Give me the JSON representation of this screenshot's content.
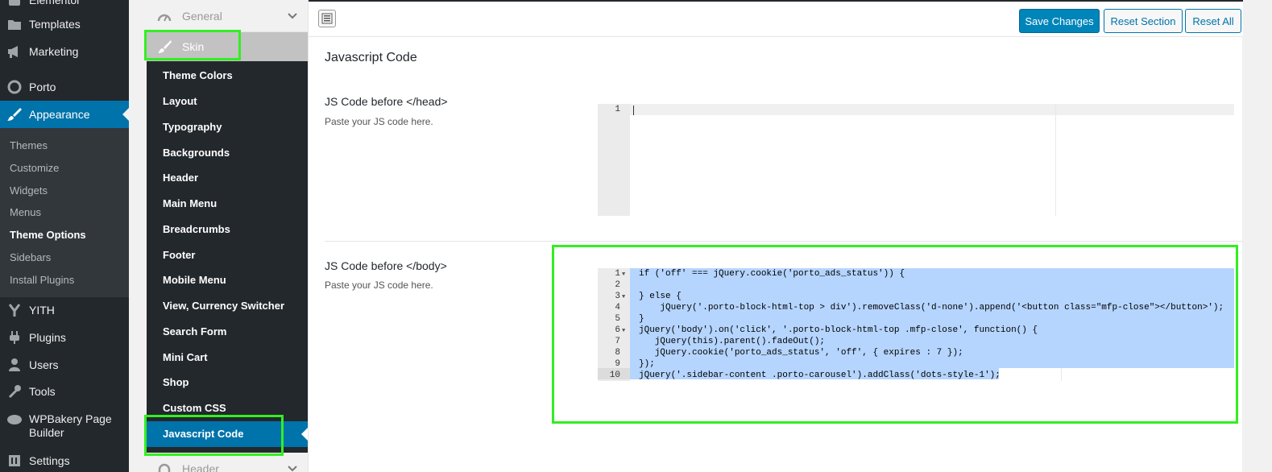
{
  "wp_menu": {
    "items": [
      {
        "label": "Elementor",
        "icon": "elementor-icon"
      },
      {
        "label": "Templates",
        "icon": "folder-icon"
      },
      {
        "label": "Marketing",
        "icon": "megaphone-icon"
      },
      {
        "label": "Porto",
        "icon": "porto-icon"
      },
      {
        "label": "Appearance",
        "icon": "paintbrush-icon"
      },
      {
        "label": "YITH",
        "icon": "yith-icon"
      },
      {
        "label": "Plugins",
        "icon": "plugin-icon"
      },
      {
        "label": "Users",
        "icon": "users-icon"
      },
      {
        "label": "Tools",
        "icon": "wrench-icon"
      },
      {
        "label": "WPBakery Page Builder",
        "icon": "wpbakery-icon"
      },
      {
        "label": "Settings",
        "icon": "settings-icon"
      }
    ],
    "submenu": [
      "Themes",
      "Customize",
      "Widgets",
      "Menus",
      "Theme Options",
      "Sidebars",
      "Install Plugins"
    ]
  },
  "options_nav": {
    "group_general": "General",
    "skin": "Skin",
    "items": [
      "Theme Colors",
      "Layout",
      "Typography",
      "Backgrounds",
      "Header",
      "Main Menu",
      "Breadcrumbs",
      "Footer",
      "Mobile Menu",
      "View, Currency Switcher",
      "Search Form",
      "Mini Cart",
      "Shop",
      "Custom CSS",
      "Javascript Code"
    ],
    "group_header": "Header"
  },
  "toolbar": {
    "save_label": "Save Changes",
    "reset_section_label": "Reset Section",
    "reset_all_label": "Reset All"
  },
  "section": {
    "title": "Javascript Code",
    "fields": [
      {
        "label": "JS Code before </head>",
        "desc": "Paste your JS code here.",
        "line_numbers": [
          "1"
        ],
        "code": []
      },
      {
        "label": "JS Code before </body>",
        "desc": "Paste your JS code here.",
        "line_numbers": [
          "1",
          "2",
          "3",
          "4",
          "5",
          "6",
          "7",
          "8",
          "9",
          "10"
        ],
        "code": [
          "if ('off' === jQuery.cookie('porto_ads_status')) {",
          "",
          "} else {",
          "    jQuery('.porto-block-html-top > div').removeClass('d-none').append('<button class=\"mfp-close\"></button>');",
          "}",
          "jQuery('body').on('click', '.porto-block-html-top .mfp-close', function() {",
          "   jQuery(this).parent().fadeOut();",
          "   jQuery.cookie('porto_ads_status', 'off', { expires : 7 });",
          "});",
          "jQuery('.sidebar-content .porto-carousel').addClass('dots-style-1');"
        ]
      }
    ]
  },
  "colors": {
    "wp_dark": "#23282d",
    "wp_blue": "#0073aa",
    "highlight_green": "#33ee22",
    "selection": "#b5d5ff"
  }
}
